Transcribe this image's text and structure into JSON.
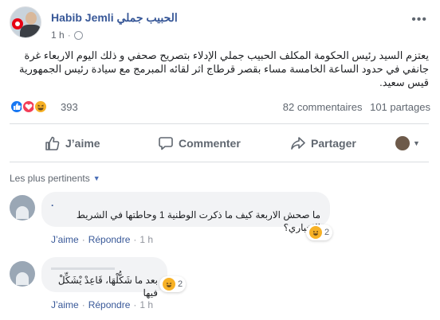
{
  "post": {
    "author": "Habib Jemli الحبيب جملي",
    "time": "1 h",
    "privacy_icon": "globe-icon",
    "text": "يعتزم السيد رئيس الحكومة المكلف الحبيب جملي الإدلاء بتصريح صحفي و ذلك اليوم الاربعاء غرة جانفي في حدود الساعة الخامسة مساء بقصر قرطاج اثر لقائه المبرمج مع سيادة رئيس الجمهورية قيس سعيد."
  },
  "reactions": {
    "count": "393",
    "comments": "82 commentaires",
    "shares": "101 partages"
  },
  "actions": {
    "like": "J’aime",
    "comment": "Commenter",
    "share": "Partager"
  },
  "sort_label": "Les plus pertinents",
  "comments": [
    {
      "name": ".",
      "text": "ما صحش الاربعة كيف ما ذكرت الوطنية 1 وحاطتها في الشريط الاخباري؟",
      "reaction_count": "2",
      "like": "J’aime",
      "reply": "Répondre",
      "time": "1 h"
    },
    {
      "name": "",
      "text": "بعد ما شَكُّلْهَا، قَاعِدْ يْشَكِّلْ فيها",
      "reaction_count": "2",
      "like": "J’aime",
      "reply": "Répondre",
      "time": "1 h"
    }
  ],
  "colors": {
    "link_blue": "#385898",
    "like_blue": "#1877f2",
    "love_red": "#f33e58",
    "haha_yellow": "#f7b125"
  }
}
